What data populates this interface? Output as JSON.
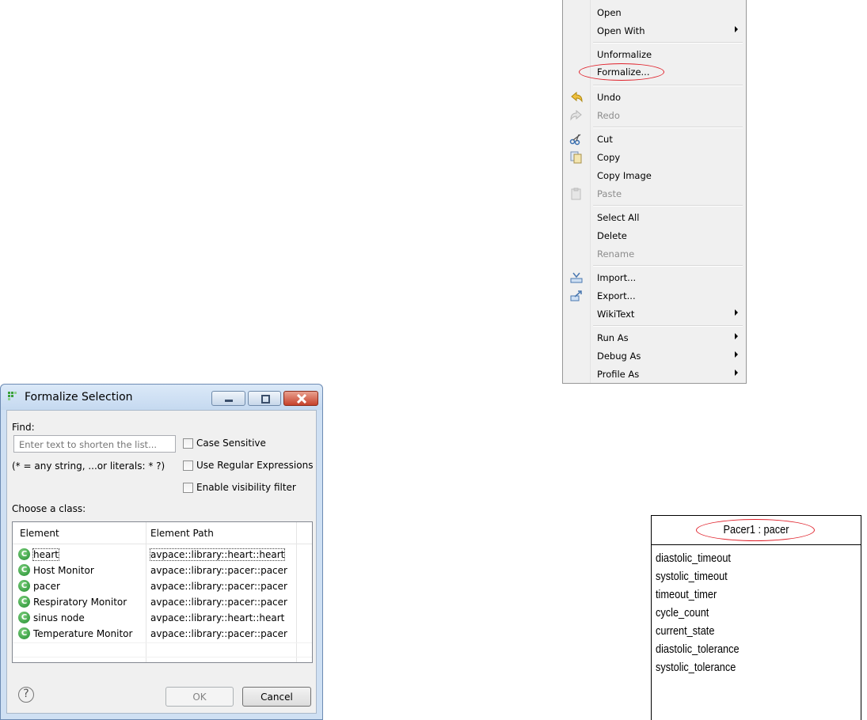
{
  "context_menu": {
    "items": [
      {
        "label": "Open"
      },
      {
        "label": "Open With",
        "submenu": true
      },
      {
        "label": "Unformalize"
      },
      {
        "label": "Formalize...",
        "highlighted_by_annotation": true
      },
      {
        "label": "Undo",
        "icon": "undo-icon"
      },
      {
        "label": "Redo",
        "icon": "redo-icon",
        "disabled": true
      },
      {
        "label": "Cut",
        "icon": "cut-icon"
      },
      {
        "label": "Copy",
        "icon": "copy-icon"
      },
      {
        "label": "Copy Image"
      },
      {
        "label": "Paste",
        "icon": "paste-icon",
        "disabled": true
      },
      {
        "label": "Select All"
      },
      {
        "label": "Delete"
      },
      {
        "label": "Rename",
        "disabled": true
      },
      {
        "label": "Import...",
        "icon": "import-icon"
      },
      {
        "label": "Export...",
        "icon": "export-icon"
      },
      {
        "label": "WikiText",
        "submenu": true
      },
      {
        "label": "Run As",
        "submenu": true
      },
      {
        "label": "Debug As",
        "submenu": true
      },
      {
        "label": "Profile As",
        "submenu": true
      }
    ]
  },
  "dialog": {
    "title": "Formalize Selection",
    "find_label": "Find:",
    "find_placeholder": "Enter text to shorten the list...",
    "hint": "(* = any string, ...or literals: * ?)",
    "checkboxes": {
      "case_sensitive": {
        "label": "Case Sensitive",
        "checked": false
      },
      "regex": {
        "label": "Use Regular Expressions",
        "checked": false
      },
      "visibility": {
        "label": "Enable visibility filter",
        "checked": false
      }
    },
    "choose_label": "Choose a class:",
    "columns": [
      "Element",
      "Element Path"
    ],
    "rows": [
      {
        "element": "heart",
        "path": "avpace::library::heart::heart",
        "selected": true
      },
      {
        "element": "Host Monitor",
        "path": "avpace::library::pacer::pacer"
      },
      {
        "element": "pacer",
        "path": "avpace::library::pacer::pacer"
      },
      {
        "element": "Respiratory Monitor",
        "path": "avpace::library::pacer::pacer"
      },
      {
        "element": "sinus node",
        "path": "avpace::library::heart::heart"
      },
      {
        "element": "Temperature Monitor",
        "path": "avpace::library::pacer::pacer"
      }
    ],
    "class_badge": "C",
    "ok_label": "OK",
    "cancel_label": "Cancel",
    "help_glyph": "?"
  },
  "uml": {
    "instance_name": "Pacer1 : pacer",
    "attributes": [
      "diastolic_timeout",
      "systolic_timeout",
      "timeout_timer",
      "cycle_count",
      "current_state",
      "diastolic_tolerance",
      "systolic_tolerance"
    ]
  },
  "colors": {
    "annotation": "#e0202a",
    "class_badge": "#2e9a3a"
  }
}
